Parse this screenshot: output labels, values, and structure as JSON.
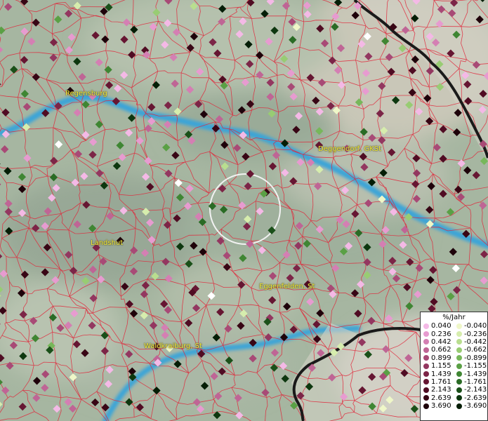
{
  "legend": {
    "title": "%/Jahr",
    "positive": [
      {
        "label": "0.040",
        "color": "#f4b9e6"
      },
      {
        "label": "0.236",
        "color": "#e79bd0"
      },
      {
        "label": "0.442",
        "color": "#d47fb3"
      },
      {
        "label": "0.662",
        "color": "#bf6595"
      },
      {
        "label": "0.899",
        "color": "#a84a76"
      },
      {
        "label": "1.155",
        "color": "#933760"
      },
      {
        "label": "1.439",
        "color": "#7c2547"
      },
      {
        "label": "1.761",
        "color": "#661632"
      },
      {
        "label": "2.143",
        "color": "#500c23"
      },
      {
        "label": "2.639",
        "color": "#380615"
      },
      {
        "label": "3.690",
        "color": "#1e020a"
      }
    ],
    "negative": [
      {
        "label": "-0.040",
        "color": "#eff7c8"
      },
      {
        "label": "-0.236",
        "color": "#d6edad"
      },
      {
        "label": "-0.442",
        "color": "#b9de8f"
      },
      {
        "label": "-0.662",
        "color": "#98cc73"
      },
      {
        "label": "-0.899",
        "color": "#77b75a"
      },
      {
        "label": "-1.155",
        "color": "#5aa045"
      },
      {
        "label": "-1.439",
        "color": "#3f8633"
      },
      {
        "label": "-1.761",
        "color": "#2a6b25"
      },
      {
        "label": "-2.143",
        "color": "#1a5019"
      },
      {
        "label": "-2.639",
        "color": "#0d370f"
      },
      {
        "label": "-3.690",
        "color": "#041d06"
      }
    ]
  },
  "places": [
    {
      "name": "Regensburg",
      "key": "regensburg"
    },
    {
      "name": "Deggendorf, GKSt",
      "key": "deggendorf"
    },
    {
      "name": "Landshut",
      "key": "landshut"
    },
    {
      "name": "Eggenfelden, St",
      "key": "eggenfelden"
    },
    {
      "name": "Waldkraiburg, St",
      "key": "waldkraiburg"
    }
  ],
  "colors": {
    "boundary": "#e0263a",
    "river": "#3aa4d8",
    "border": "#1a1a1a",
    "terrain": "#a9b9a6",
    "selection_ring": "#f2f2f2"
  }
}
